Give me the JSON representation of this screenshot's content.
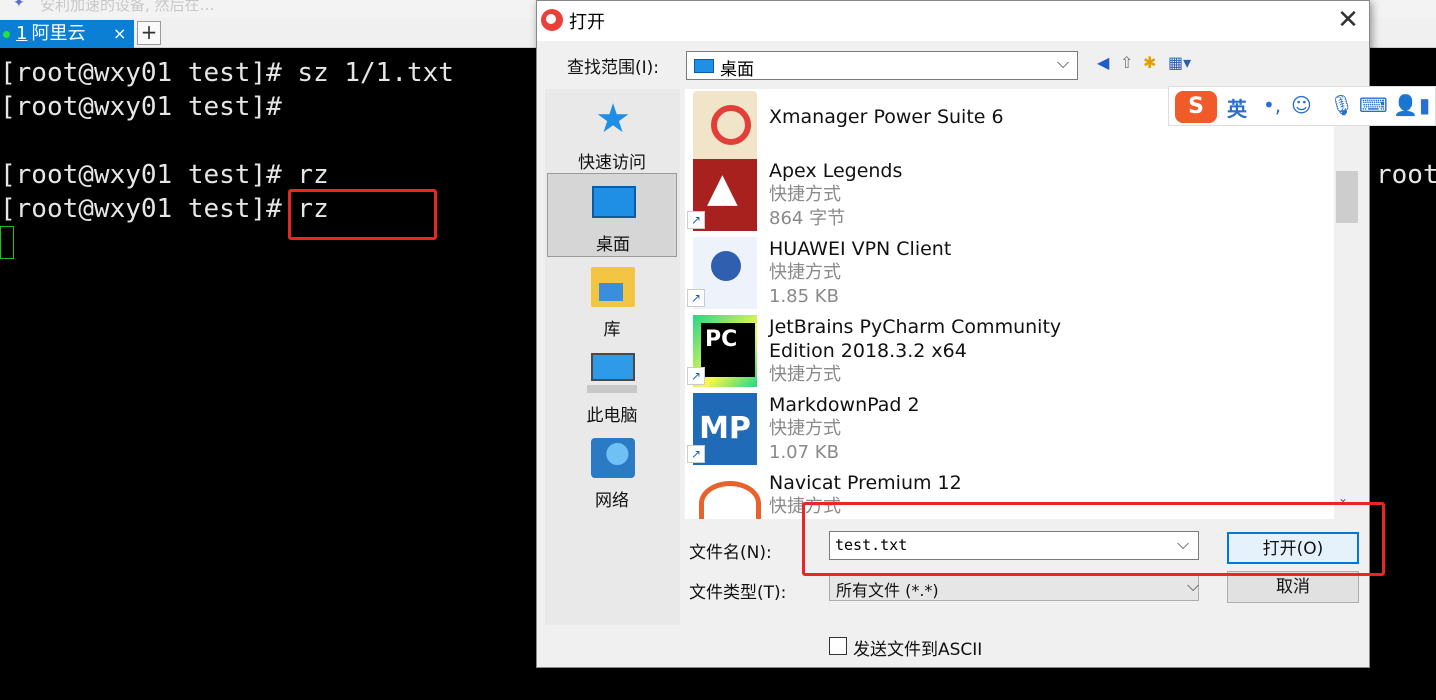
{
  "hint": {
    "text": "安利加速的设备, 然后在…"
  },
  "tabs": [
    {
      "number": "1",
      "label": "阿里云",
      "close": "×"
    }
  ],
  "tab_add": "+",
  "terminal": {
    "lines": [
      "[root@wxy01 test]# sz 1/1.txt",
      "[root@wxy01 test]#",
      "[root@wxy01 test]# rz",
      "[root@wxy01 test]# rz"
    ],
    "right_text": "root"
  },
  "dialog": {
    "title": "打开",
    "close": "✕",
    "look_in_label": "查找范围(I):",
    "look_in_value": "桌面",
    "places": [
      {
        "label": "快速访问",
        "icon": "star-icon"
      },
      {
        "label": "桌面",
        "icon": "desktop-icon"
      },
      {
        "label": "库",
        "icon": "library-icon"
      },
      {
        "label": "此电脑",
        "icon": "computer-icon"
      },
      {
        "label": "网络",
        "icon": "network-icon"
      }
    ],
    "files": [
      {
        "name": "Xmanager Power Suite 6",
        "sub": []
      },
      {
        "name": "Apex Legends",
        "sub": [
          "快捷方式",
          "864 字节"
        ]
      },
      {
        "name": "HUAWEI VPN Client",
        "sub": [
          "快捷方式",
          "1.85 KB"
        ]
      },
      {
        "name": "JetBrains PyCharm Community\nEdition 2018.3.2 x64",
        "sub": [
          "快捷方式"
        ]
      },
      {
        "name": "MarkdownPad 2",
        "sub": [
          "快捷方式",
          "1.07 KB"
        ]
      },
      {
        "name": "Navicat Premium 12",
        "sub": [
          "快捷方式"
        ]
      }
    ],
    "filename_label": "文件名(N):",
    "filename_value": "test.txt",
    "filetype_label": "文件类型(T):",
    "filetype_value": "所有文件 (*.*)",
    "open_button": "打开(O)",
    "cancel_button": "取消",
    "ascii_label": "发送文件到ASCII"
  },
  "ime": {
    "logo": "S",
    "mode": "英"
  },
  "colors": {
    "accent": "#0a7fd3",
    "highlight": "#e72626"
  }
}
